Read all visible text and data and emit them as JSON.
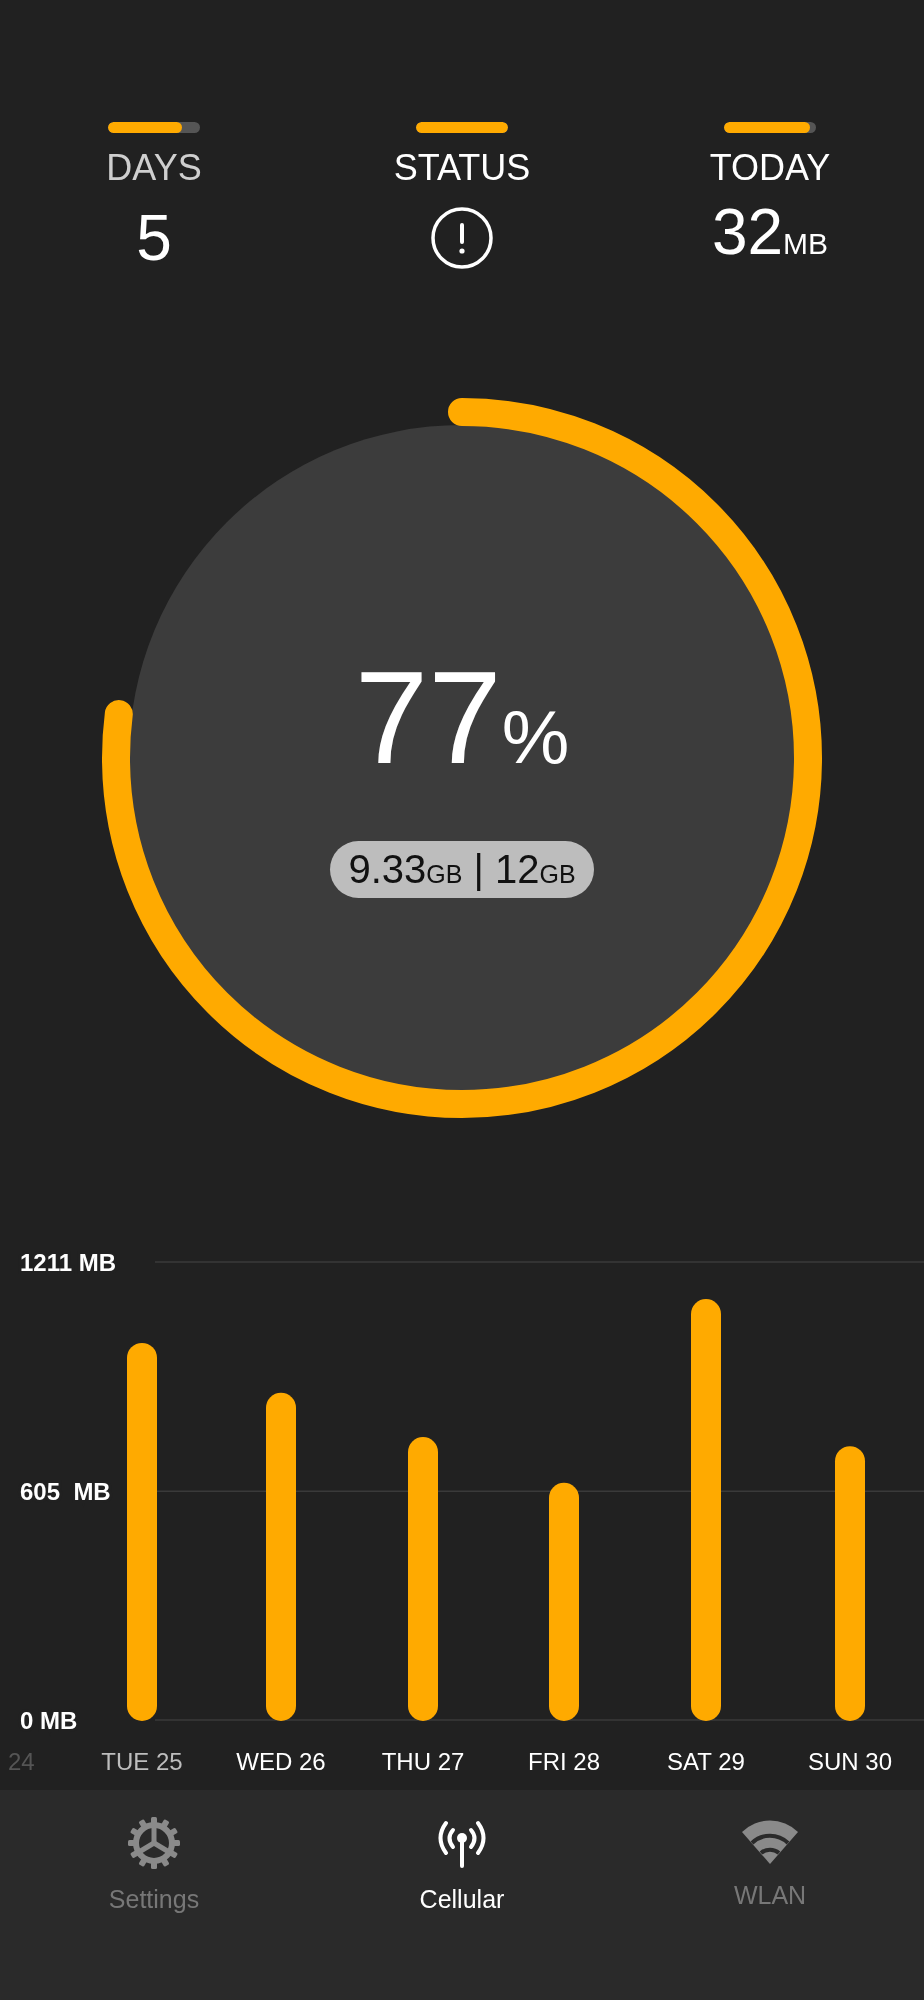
{
  "stats": [
    {
      "kind": "text",
      "label": "DAYS",
      "value": "5",
      "level": 0.8,
      "dim": true
    },
    {
      "kind": "icon",
      "label": "STATUS",
      "level": 1,
      "dim": false
    },
    {
      "kind": "text",
      "label": "TODAY",
      "value": "32",
      "unit": "MB",
      "level": 0.93,
      "dim": false
    }
  ],
  "usage": {
    "percent": "77",
    "percent_sign": "%",
    "level": 0.77,
    "used": "9.33",
    "used_unit": "GB",
    "separator": "|",
    "total": "12",
    "total_unit": "GB"
  },
  "chart": {
    "previous_label": "24",
    "bars": [
      {
        "highlighted": true
      },
      {
        "highlighted": false
      },
      {
        "highlighted": false
      },
      {
        "highlighted": false
      },
      {
        "highlighted": false
      },
      {
        "highlighted": false
      }
    ],
    "chart_data": {
      "type": "bar",
      "categories": [
        "TUE 25",
        "WED 26",
        "THU 27",
        "FRI 28",
        "SAT 29",
        "SUN 30"
      ],
      "series": [
        {
          "color": "#ffaa00",
          "values": [
            997,
            865,
            748,
            627,
            1113,
            724
          ]
        }
      ],
      "ylim": [
        0,
        1211
      ],
      "yticks": [
        {
          "value": 0,
          "label": "0 MB"
        },
        {
          "value": 605,
          "label": "605  MB"
        },
        {
          "value": 1211,
          "label": "1211 MB"
        }
      ]
    }
  },
  "tabs": [
    {
      "kind": "gear",
      "label": "Settings",
      "selected": false
    },
    {
      "kind": "antenna",
      "label": "Cellular",
      "selected": true
    },
    {
      "kind": "wifi",
      "label": "WLAN",
      "selected": false
    }
  ]
}
